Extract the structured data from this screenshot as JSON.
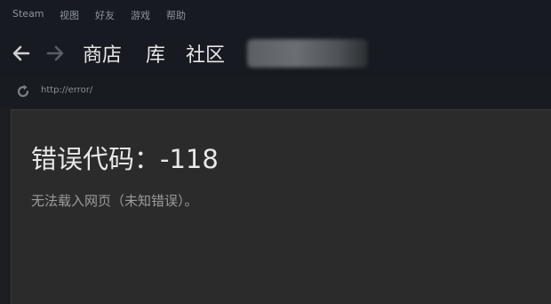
{
  "menubar": {
    "items": [
      {
        "label": "Steam"
      },
      {
        "label": "视图"
      },
      {
        "label": "好友"
      },
      {
        "label": "游戏"
      },
      {
        "label": "帮助"
      }
    ]
  },
  "navbar": {
    "back_icon": "arrow-left-icon",
    "forward_icon": "arrow-right-icon",
    "tabs": [
      {
        "label": "商店"
      },
      {
        "label": "库"
      },
      {
        "label": "社区"
      }
    ]
  },
  "urlbar": {
    "reload_icon": "reload-icon",
    "url": "http://error/"
  },
  "error": {
    "title": "错误代码：-118",
    "description": "无法载入网页（未知错误）。"
  },
  "colors": {
    "background": "#1c1e22",
    "menubar": "#171a21",
    "content": "#2b2b2b",
    "title_text": "#e8e8e8",
    "desc_text": "#9b9b9b"
  }
}
